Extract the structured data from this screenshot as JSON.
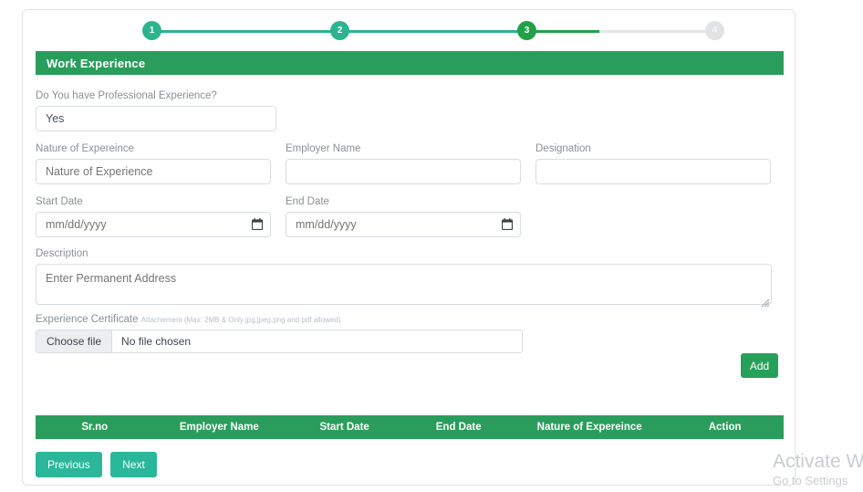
{
  "stepper": {
    "steps": [
      {
        "number": "1",
        "state": "done"
      },
      {
        "number": "2",
        "state": "done"
      },
      {
        "number": "3",
        "state": "current"
      },
      {
        "number": "4",
        "state": "todo"
      }
    ],
    "active_color": "#2db38f",
    "current_color": "#22a04a",
    "inactive_color": "#e0e2e4"
  },
  "section": {
    "title": "Work Experience",
    "bar_color": "#2a9d5c"
  },
  "form": {
    "professional_experience": {
      "label": "Do You have Professional Experience?",
      "value": "Yes"
    },
    "nature_of_experience": {
      "label": "Nature of Expereince",
      "placeholder": "Nature of Experience",
      "value": ""
    },
    "employer_name": {
      "label": "Employer Name",
      "placeholder": "",
      "value": ""
    },
    "designation": {
      "label": "Designation",
      "placeholder": "",
      "value": ""
    },
    "start_date": {
      "label": "Start Date",
      "placeholder": "mm/dd/yyyy",
      "value": ""
    },
    "end_date": {
      "label": "End Date",
      "placeholder": "mm/dd/yyyy",
      "value": ""
    },
    "description": {
      "label": "Description",
      "placeholder": "Enter Permanent Address",
      "value": ""
    },
    "experience_certificate": {
      "label": "Experience Certificate",
      "hint": "Attachement (Max: 2MB & Only jpg,jpeg,png and pdf allowed)",
      "choose_file_label": "Choose file",
      "file_status": "No file chosen"
    },
    "add_button": "Add"
  },
  "table": {
    "headers": [
      "Sr.no",
      "Employer Name",
      "Start Date",
      "End Date",
      "Nature of Expereince",
      "Action"
    ],
    "rows": []
  },
  "footer": {
    "previous_label": "Previous",
    "next_label": "Next",
    "button_color": "#2bb79a"
  },
  "watermark": {
    "line1": "Activate Wi",
    "line2": "Go to Settings"
  }
}
